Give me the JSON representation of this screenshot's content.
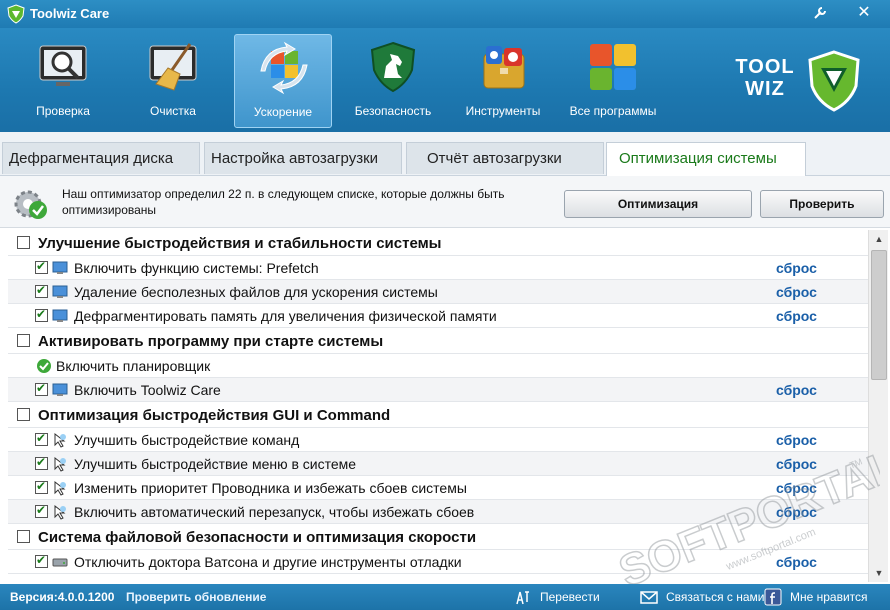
{
  "window": {
    "title": "Toolwiz Care",
    "settings_icon": "wrench-icon",
    "close_glyph": "✕"
  },
  "toolbar": {
    "items": [
      {
        "label": "Проверка",
        "icon": "magnifier-monitor-icon"
      },
      {
        "label": "Очистка",
        "icon": "broom-icon"
      },
      {
        "label": "Ускорение",
        "icon": "speedup-arrows-icon"
      },
      {
        "label": "Безопасность",
        "icon": "horse-shield-icon"
      },
      {
        "label": "Инструменты",
        "icon": "tools-box-icon"
      },
      {
        "label": "Все программы",
        "icon": "all-apps-grid-icon"
      }
    ],
    "active_index": 2,
    "brand_line1": "TOOL",
    "brand_line2": "WIZ"
  },
  "tabs": [
    {
      "label": "Дефрагментация диска"
    },
    {
      "label": "Настройка автозагрузки"
    },
    {
      "label": "Отчёт автозагрузки"
    },
    {
      "label": "Оптимизация системы"
    }
  ],
  "info": {
    "message": "Наш оптимизатор определил 22  п. в следующем списке, которые должны быть оптимизированы",
    "optimize_button": "Оптимизация",
    "check_button": "Проверить"
  },
  "list": {
    "reset_label": "сброс",
    "groups": [
      {
        "label": "Улучшение быстродействия и стабильности системы",
        "items": [
          "Включить функцию системы: Prefetch",
          "Удаление бесполезных файлов для ускорения системы",
          "Дефрагментировать память для  увеличения физической памяти"
        ]
      },
      {
        "label": "Активировать программу при старте системы",
        "plain_item": "Включить планировщик",
        "items": [
          "Включить Toolwiz Care"
        ]
      },
      {
        "label": "Оптимизация быстродействия GUI и Command",
        "items": [
          "Улучшить быстродействие команд",
          "Улучшить быстродействие меню в системе",
          "Изменить приоритет Проводника и избежать сбоев системы",
          "Включить автоматический перезапуск, чтобы избежать сбоев"
        ]
      },
      {
        "label": "Система файловой безопасности и оптимизация скорости",
        "items": [
          "Отключить доктора Ватсона и другие инструменты отладки"
        ]
      }
    ]
  },
  "status": {
    "version": "Версия:4.0.0.1200",
    "update": "Проверить обновление",
    "translate": "Перевести",
    "contact": "Связаться с нами",
    "like": "Мне нравится"
  },
  "watermark": {
    "text": "SOFTPORTAL",
    "url": "www.softportal.com",
    "tm": "TM"
  },
  "colors": {
    "accent_blue": "#1f7bb3",
    "reset_link": "#1a5fa8",
    "active_tab_text": "#1a7a1a",
    "check_green": "#1a7a1a"
  }
}
